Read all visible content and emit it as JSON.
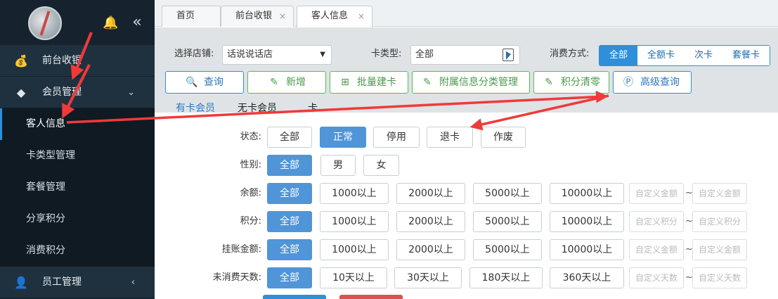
{
  "sidebar": {
    "menu": [
      {
        "label": "前台收银",
        "icon": "money-bag-icon"
      },
      {
        "label": "会员管理",
        "icon": "diamond-icon",
        "expanded": true,
        "children": [
          "客人信息",
          "卡类型管理",
          "套餐管理",
          "分享积分",
          "消费积分"
        ]
      },
      {
        "label": "员工管理",
        "icon": "user-icon",
        "expanded": false
      }
    ],
    "active_child": "客人信息",
    "collapse_glyph": "«"
  },
  "tabs": [
    {
      "label": "首页"
    },
    {
      "label": "前台收银",
      "close": "×"
    },
    {
      "label": "客人信息",
      "close": "×"
    }
  ],
  "filter": {
    "store_label": "选择店铺:",
    "store_value": "话说说话店",
    "card_type_label": "卡类型:",
    "card_type_value": "全部",
    "pay_label": "消费方式:",
    "pay_options": [
      "全部",
      "全额卡",
      "次卡",
      "套餐卡"
    ],
    "pay_selected": "全部",
    "buttons": [
      {
        "label": "查询",
        "icon": "search-icon",
        "style": "blue"
      },
      {
        "label": "新增",
        "icon": "add-icon",
        "style": "green"
      },
      {
        "label": "批量建卡",
        "icon": "plus-box-icon",
        "style": "green"
      },
      {
        "label": "附属信息分类管理",
        "icon": "edit-icon",
        "style": "green"
      },
      {
        "label": "积分清零",
        "icon": "edit-icon",
        "style": "green"
      },
      {
        "label": "高级查询",
        "icon": "advanced-search-icon",
        "style": "blue"
      }
    ],
    "subtabs": [
      "有卡会员",
      "无卡会员",
      "…卡"
    ]
  },
  "rows": [
    {
      "label": "状态:",
      "options": [
        "全部",
        "正常",
        "停用",
        "退卡",
        "作废"
      ],
      "selected": "正常"
    },
    {
      "label": "性别:",
      "options": [
        "全部",
        "男",
        "女"
      ],
      "selected": "全部"
    },
    {
      "label": "余额:",
      "options": [
        "全部",
        "1000以上",
        "2000以上",
        "5000以上",
        "10000以上"
      ],
      "selected": "全部",
      "custom": [
        "自定义金额",
        "自定义金额"
      ]
    },
    {
      "label": "积分:",
      "options": [
        "全部",
        "1000以上",
        "2000以上",
        "5000以上",
        "10000以上"
      ],
      "selected": "全部",
      "custom": [
        "自定义积分",
        "自定义积分"
      ]
    },
    {
      "label": "挂账金额:",
      "options": [
        "全部",
        "1000以上",
        "2000以上",
        "5000以上",
        "10000以上"
      ],
      "selected": "全部",
      "custom": [
        "自定义金额",
        "自定义金额"
      ]
    },
    {
      "label": "未消费天数:",
      "options": [
        "全部",
        "10天以上",
        "30天以上",
        "180天以上",
        "360天以上"
      ],
      "selected": "全部",
      "custom": [
        "自定义天数",
        "自定义天数"
      ]
    }
  ],
  "colors": {
    "accent": "#2f8fd8",
    "annotation": "#f03a3a",
    "sidebar": "#1b2a36"
  }
}
